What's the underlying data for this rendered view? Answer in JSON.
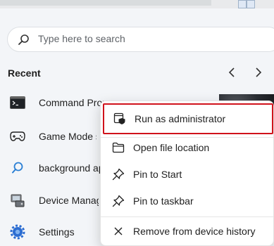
{
  "search": {
    "placeholder": "Type here to search"
  },
  "recent": {
    "label": "Recent",
    "items": [
      {
        "label": "Command Prompt",
        "icon": "command-prompt-icon"
      },
      {
        "label": "Game Mode settings",
        "icon": "gamepad-icon"
      },
      {
        "label": "background apps",
        "icon": "search-icon"
      },
      {
        "label": "Device Manager",
        "icon": "device-manager-icon"
      },
      {
        "label": "Settings",
        "icon": "gear-icon"
      }
    ]
  },
  "context_menu": {
    "items": [
      {
        "label": "Run as administrator",
        "icon": "shield-icon"
      },
      {
        "label": "Open file location",
        "icon": "folder-icon"
      },
      {
        "label": "Pin to Start",
        "icon": "pin-icon"
      },
      {
        "label": "Pin to taskbar",
        "icon": "pin-icon"
      },
      {
        "label": "Remove from device history",
        "icon": "close-icon"
      }
    ]
  },
  "colors": {
    "highlight_border": "#d0121b",
    "background": "#f3f5f8"
  }
}
